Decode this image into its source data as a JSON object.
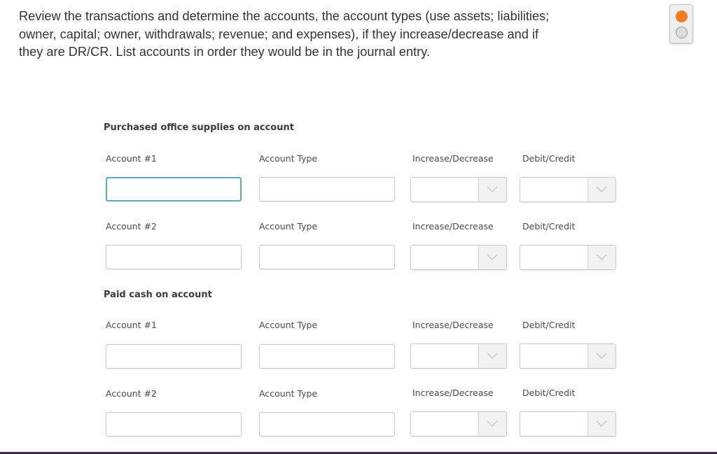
{
  "instructions": "Review the transactions and determine the accounts, the account types (use assets; liabilities; owner, capital; owner, withdrawals; revenue; and expenses), if they increase/decrease and if they are DR/CR. List accounts in order they would be in the journal entry.",
  "toggle": {
    "icon": "radio-toggle-icon",
    "active_color": "#f47b20"
  },
  "transactions": [
    {
      "title": "Purchased office supplies on account",
      "rows": [
        {
          "account_label": "Account #1",
          "type_label": "Account Type",
          "incdec_label": "Increase/Decrease",
          "drcr_label": "Debit/Credit",
          "account_value": "",
          "type_value": "",
          "incdec_value": "",
          "drcr_value": ""
        },
        {
          "account_label": "Account #2",
          "type_label": "Account Type",
          "incdec_label": "Increase/Decrease",
          "drcr_label": "Debit/Credit",
          "account_value": "",
          "type_value": "",
          "incdec_value": "",
          "drcr_value": ""
        }
      ]
    },
    {
      "title": "Paid cash on account",
      "rows": [
        {
          "account_label": "Account #1",
          "type_label": "Account Type",
          "incdec_label": "Increase/Decrease",
          "drcr_label": "Debit/Credit",
          "account_value": "",
          "type_value": "",
          "incdec_value": "",
          "drcr_value": ""
        },
        {
          "account_label": "Account #2",
          "type_label": "Account Type",
          "incdec_label": "Increase/Decrease",
          "drcr_label": "Debit/Credit",
          "account_value": "",
          "type_value": "",
          "incdec_value": "",
          "drcr_value": ""
        }
      ]
    }
  ],
  "colors": {
    "focus_border": "#5ea8c4",
    "text": "#333333"
  }
}
